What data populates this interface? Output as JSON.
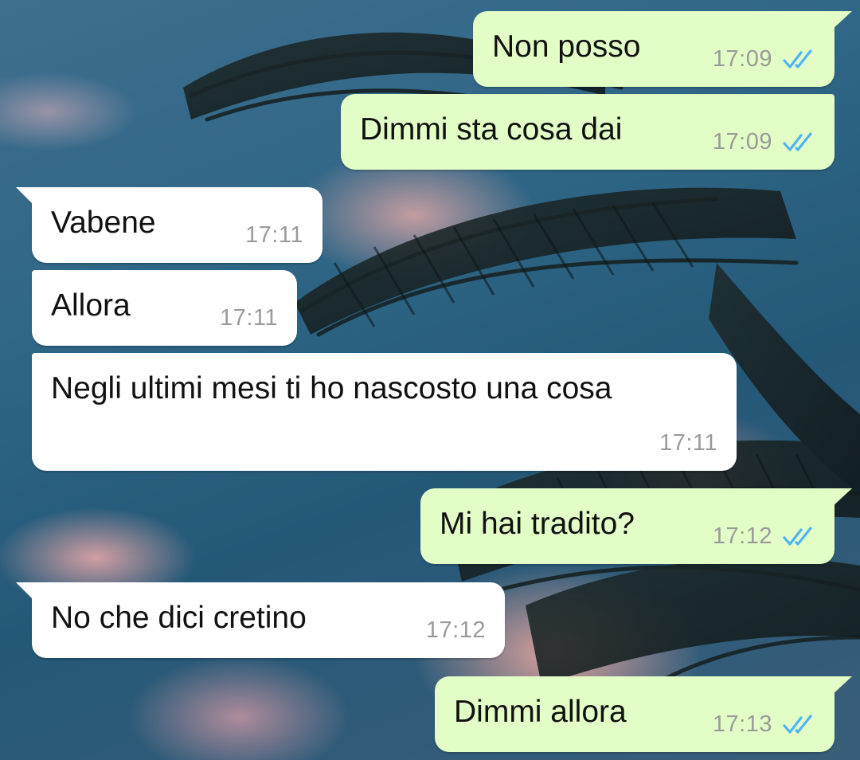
{
  "theme": {
    "incoming_bubble": "#ffffff",
    "outgoing_bubble": "#e2fec6",
    "read_tick_color": "#4fb3f6",
    "time_color": "#9a9a9a"
  },
  "messages": [
    {
      "direction": "outgoing",
      "text": "Non posso",
      "time": "17:09",
      "status": "read-double-tick-icon"
    },
    {
      "direction": "outgoing",
      "text": "Dimmi sta cosa dai",
      "time": "17:09",
      "status": "read-double-tick-icon"
    },
    {
      "direction": "incoming",
      "text": "Vabene",
      "time": "17:11"
    },
    {
      "direction": "incoming",
      "text": "Allora",
      "time": "17:11"
    },
    {
      "direction": "incoming",
      "text": "Negli ultimi mesi ti ho nascosto una cosa",
      "time": "17:11"
    },
    {
      "direction": "outgoing",
      "text": "Mi hai tradito?",
      "time": "17:12",
      "status": "read-double-tick-icon"
    },
    {
      "direction": "incoming",
      "text": "No che dici cretino",
      "time": "17:12"
    },
    {
      "direction": "outgoing",
      "text": "Dimmi allora",
      "time": "17:13",
      "status": "read-double-tick-icon"
    }
  ]
}
